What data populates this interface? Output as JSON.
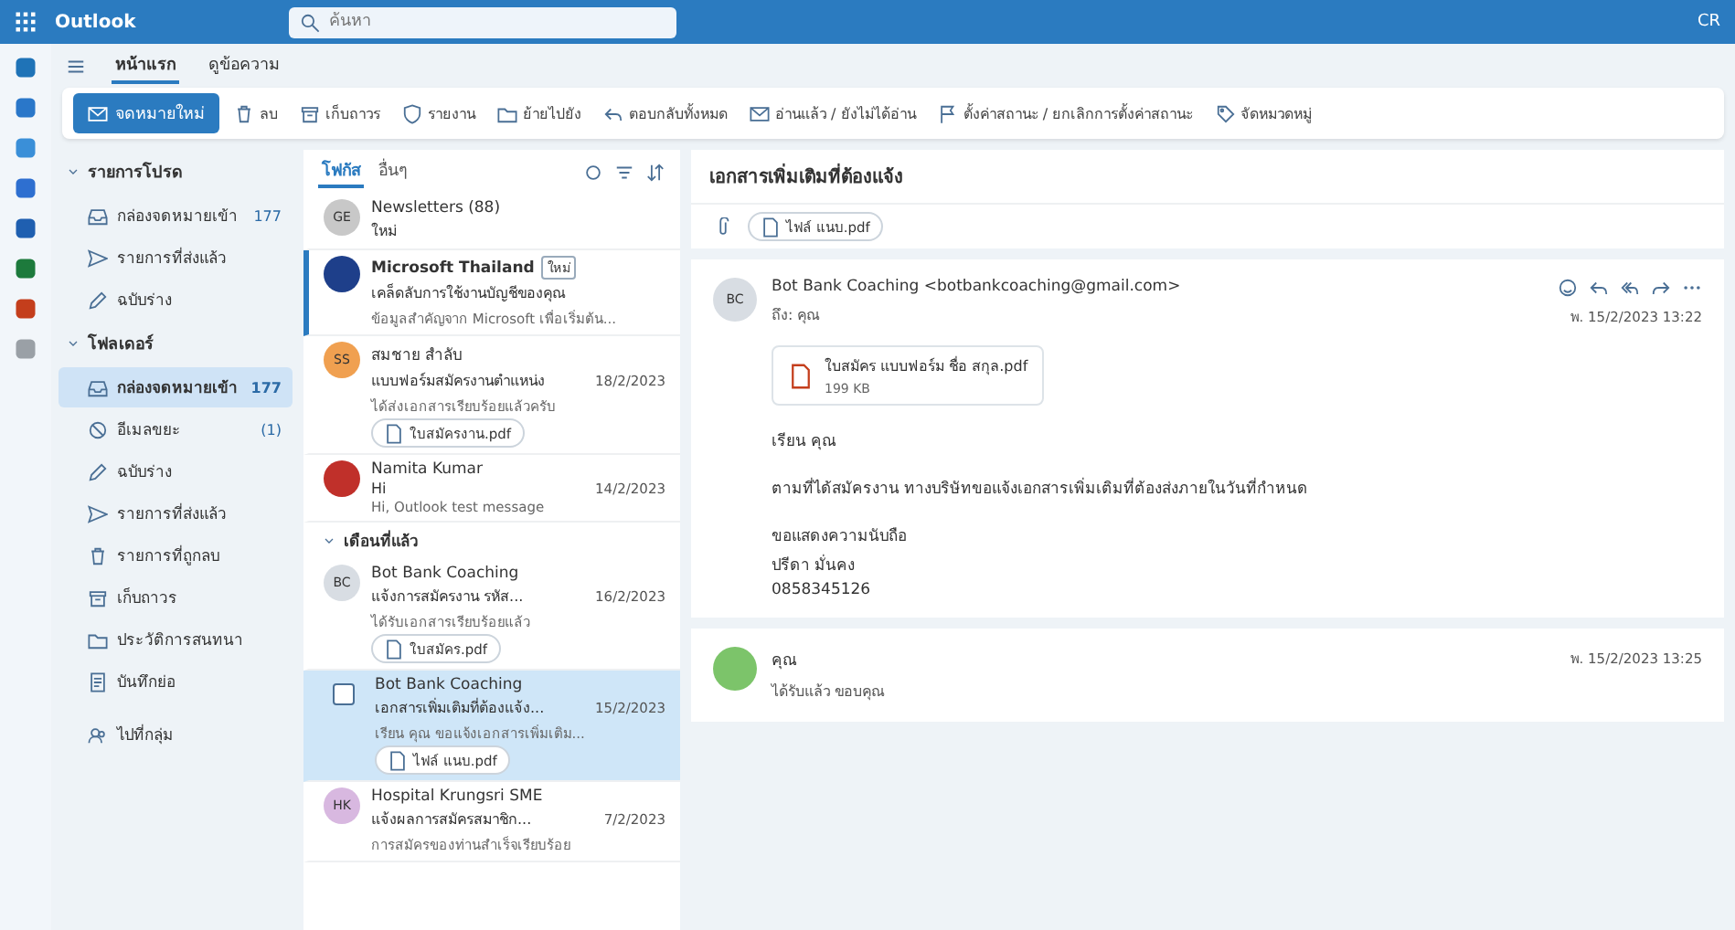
{
  "top_bar": {
    "app_name": "Outlook",
    "search": {
      "placeholder": "ค้นหา"
    },
    "account": "CR"
  },
  "tabs": [
    {
      "label": "หน้าแรก",
      "selected": true
    },
    {
      "label": "ดูข้อความ",
      "selected": false
    }
  ],
  "ribbon": {
    "new_button": "จดหมายใหม่",
    "items": [
      {
        "label": "ลบ",
        "kind": "trash"
      },
      {
        "label": "เก็บถาวร",
        "kind": "archive"
      },
      {
        "label": "รายงาน",
        "kind": "shield"
      },
      {
        "label": "ย้ายไปยัง",
        "kind": "folder"
      },
      {
        "label": "ตอบกลับทั้งหมด",
        "kind": "reply"
      },
      {
        "label": "อ่านแล้ว / ยังไม่ได้อ่าน",
        "kind": "mail"
      },
      {
        "label": "ตั้งค่าสถานะ / ยกเลิกการตั้งค่าสถานะ",
        "kind": "flag"
      },
      {
        "label": "จัดหมวดหมู่",
        "kind": "tag"
      }
    ]
  },
  "folders": {
    "sections": [
      {
        "title": "รายการโปรด",
        "expanded": true,
        "items": [
          {
            "label": "กล่องจดหมายเข้า",
            "count": "177",
            "kind": "inbox",
            "selected": false
          },
          {
            "label": "รายการที่ส่งแล้ว",
            "kind": "send",
            "selected": false
          },
          {
            "label": "ฉบับร่าง",
            "kind": "pencil",
            "selected": false
          }
        ]
      },
      {
        "title": "โฟลเดอร์",
        "expanded": true,
        "items": [
          {
            "label": "กล่องจดหมายเข้า",
            "count": "177",
            "kind": "inbox",
            "selected": true
          },
          {
            "label": "อีเมลขยะ",
            "count": "(1)",
            "kind": "junk",
            "selected": false
          },
          {
            "label": "ฉบับร่าง",
            "kind": "pencil",
            "selected": false
          },
          {
            "label": "รายการที่ส่งแล้ว",
            "kind": "send",
            "selected": false
          },
          {
            "label": "รายการที่ถูกลบ",
            "kind": "trash",
            "selected": false
          },
          {
            "label": "เก็บถาวร",
            "kind": "archive",
            "selected": false
          },
          {
            "label": "ประวัติการสนทนา",
            "kind": "folder",
            "selected": false
          },
          {
            "label": "บันทึกย่อ",
            "kind": "note",
            "selected": false
          }
        ]
      }
    ],
    "link": "ไปที่กลุ่ม"
  },
  "message_list": {
    "pivots": [
      {
        "label": "โฟกัส",
        "selected": true
      },
      {
        "label": "อื่นๆ",
        "selected": false
      }
    ],
    "items": [
      {
        "kind": "message",
        "sender": "Newsletters (88)",
        "subject": "ใหม่",
        "avatar": "GE",
        "color": "#c8c8c8",
        "selected": false,
        "unread": false
      },
      {
        "kind": "message",
        "sender": "Microsoft Thailand",
        "tag": "ใหม่",
        "subject": "เคล็ดลับการใช้งานบัญชีของคุณ",
        "preview": "ข้อมูลสำคัญจาก Microsoft เพื่อเริ่มต้น...",
        "color": "#1e3f8a",
        "selected": false,
        "unread": true
      },
      {
        "kind": "message",
        "sender": "สมชาย สำลับ",
        "subject": "แบบฟอร์มสมัครงานตำแหน่ง",
        "date": "18/2/2023",
        "preview": "ได้ส่งเอกสารเรียบร้อยแล้วครับ",
        "attachment": "ใบสมัครงาน.pdf",
        "avatar": "SS",
        "color": "#f0a050",
        "selected": false,
        "unread": false
      },
      {
        "kind": "message",
        "sender": "Namita Kumar",
        "subject": "Hi",
        "date": "14/2/2023",
        "preview": "Hi, Outlook test message",
        "color": "#c0302a",
        "selected": false,
        "unread": false
      },
      {
        "kind": "group",
        "label": "เดือนที่แล้ว"
      },
      {
        "kind": "message",
        "sender": "Bot Bank Coaching",
        "subject": "แจ้งการสมัครงาน รหัส...",
        "date": "16/2/2023",
        "preview": "ได้รับเอกสารเรียบร้อยแล้ว",
        "attachment": "ใบสมัคร.pdf",
        "avatar": "BC",
        "color": "#d8dde3",
        "selected": false,
        "unread": false
      },
      {
        "kind": "message",
        "sender": "Bot Bank Coaching",
        "subject": "เอกสารเพิ่มเติมที่ต้องแจ้ง...",
        "date": "15/2/2023",
        "preview": "เรียน คุณ ขอแจ้งเอกสารเพิ่มเติม...",
        "attachment": "ไฟล์ แนบ.pdf",
        "selected": true,
        "unread": false
      },
      {
        "kind": "message",
        "sender": "Hospital Krungsri SME",
        "subject": "แจ้งผลการสมัครสมาชิก...",
        "date": "7/2/2023",
        "preview": "การสมัครของท่านสำเร็จเรียบร้อย",
        "avatar": "HK",
        "color": "#d8b8e0",
        "selected": false,
        "unread": false
      }
    ]
  },
  "reading_pane": {
    "subject": "เอกสารเพิ่มเติมที่ต้องแจ้ง",
    "attachment": "ไฟล์ แนบ.pdf",
    "messages": [
      {
        "kind": "full",
        "avatar": "BC",
        "color": "#d8dde3",
        "from": "Bot Bank Coaching <botbankcoaching@gmail.com>",
        "to": "ถึง: คุณ",
        "date": "พ. 15/2/2023 13:22",
        "attachment": {
          "name": "ใบสมัคร แบบฟอร์ม ชื่อ สกุล.pdf",
          "size": "199 KB"
        },
        "body": [
          "เรียน คุณ",
          "ตามที่ได้สมัครงาน ทางบริษัทขอแจ้งเอกสารเพิ่มเติมที่ต้องส่งภายในวันที่กำหนด",
          "ขอแสดงความนับถือ",
          "ปรีดา มั่นคง",
          "0858345126"
        ]
      },
      {
        "kind": "collapsed",
        "color": "#7cc46a",
        "from": "คุณ",
        "preview": "ได้รับแล้ว ขอบคุณ",
        "date": "พ. 15/2/2023 13:25"
      }
    ]
  }
}
